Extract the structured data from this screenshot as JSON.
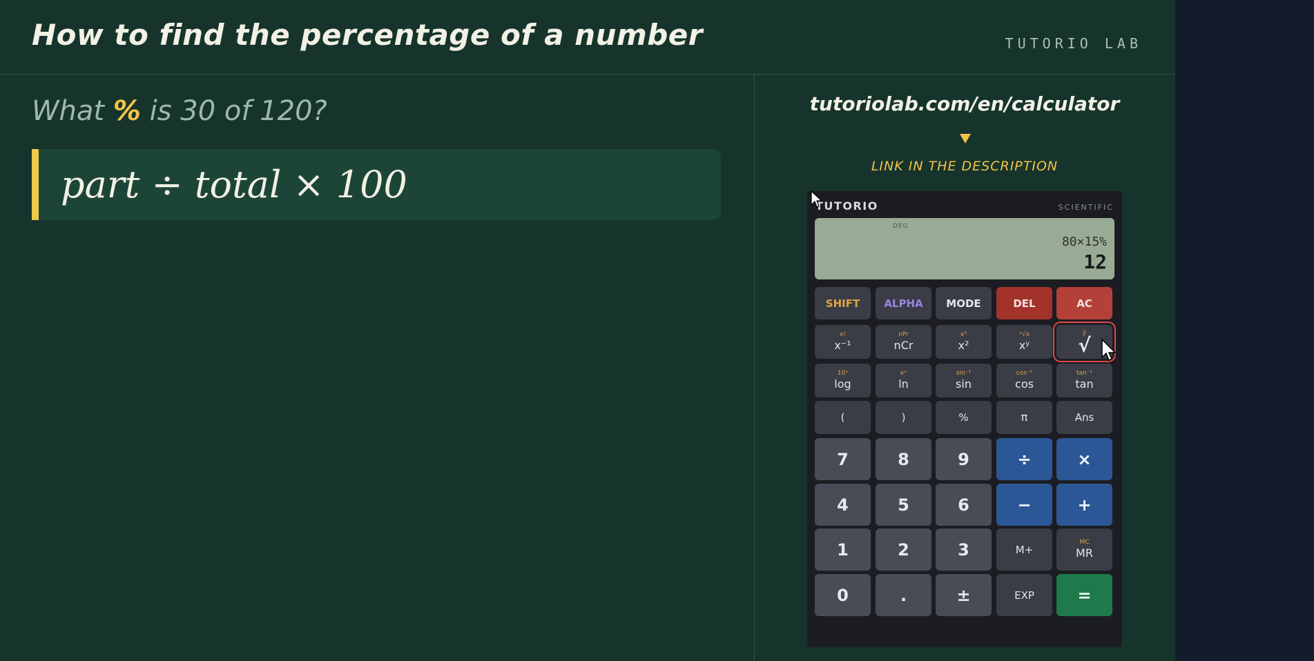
{
  "header": {
    "title": "How to find the percentage of a number",
    "brand": "TUTORIO LAB"
  },
  "lesson": {
    "question_prefix": "What",
    "question_symbol": "%",
    "question_suffix": "is 30 of 120?",
    "formula": "part ÷ total × 100"
  },
  "promo": {
    "url": "tutoriolab.com/en/calculator",
    "cta": "LINK IN THE DESCRIPTION"
  },
  "calculator": {
    "brand": "TUTORIO",
    "model": "SCIENTIFIC",
    "display": {
      "mode": "DEG",
      "expression": "80×15%",
      "result": "12"
    },
    "rows": [
      [
        {
          "name": "shift-key",
          "sub": "",
          "label": "SHIFT",
          "style": "top shift"
        },
        {
          "name": "alpha-key",
          "sub": "",
          "label": "ALPHA",
          "style": "top alpha"
        },
        {
          "name": "mode-key",
          "sub": "",
          "label": "MODE",
          "style": "top"
        },
        {
          "name": "del-key",
          "sub": "",
          "label": "DEL",
          "style": "top red"
        },
        {
          "name": "ac-key",
          "sub": "",
          "label": "AC",
          "style": "top red2"
        }
      ],
      [
        {
          "name": "reciprocal-key",
          "sub": "x!",
          "label": "x⁻¹",
          "style": ""
        },
        {
          "name": "ncr-key",
          "sub": "nPr",
          "label": "nCr",
          "style": ""
        },
        {
          "name": "square-key",
          "sub": "x³",
          "label": "x²",
          "style": ""
        },
        {
          "name": "power-key",
          "sub": "ˣ√x",
          "label": "xʸ",
          "style": ""
        },
        {
          "name": "sqrt-key",
          "sub": "∛",
          "label": "√",
          "style": "sel"
        }
      ],
      [
        {
          "name": "log-key",
          "sub": "10ˣ",
          "label": "log",
          "style": ""
        },
        {
          "name": "ln-key",
          "sub": "eˣ",
          "label": "ln",
          "style": ""
        },
        {
          "name": "sin-key",
          "sub": "sin⁻¹",
          "label": "sin",
          "style": ""
        },
        {
          "name": "cos-key",
          "sub": "cos⁻¹",
          "label": "cos",
          "style": ""
        },
        {
          "name": "tan-key",
          "sub": "tan⁻¹",
          "label": "tan",
          "style": ""
        }
      ],
      [
        {
          "name": "open-paren-key",
          "sub": "",
          "label": "(",
          "style": "small"
        },
        {
          "name": "close-paren-key",
          "sub": "",
          "label": ")",
          "style": "small"
        },
        {
          "name": "percent-key",
          "sub": "",
          "label": "%",
          "style": "small"
        },
        {
          "name": "pi-key",
          "sub": "",
          "label": "π",
          "style": ""
        },
        {
          "name": "ans-key",
          "sub": "",
          "label": "Ans",
          "style": "small"
        }
      ],
      [
        {
          "name": "digit-7-key",
          "sub": "",
          "label": "7",
          "style": "num"
        },
        {
          "name": "digit-8-key",
          "sub": "",
          "label": "8",
          "style": "num"
        },
        {
          "name": "digit-9-key",
          "sub": "",
          "label": "9",
          "style": "num"
        },
        {
          "name": "divide-key",
          "sub": "",
          "label": "÷",
          "style": "op"
        },
        {
          "name": "multiply-key",
          "sub": "",
          "label": "×",
          "style": "op"
        }
      ],
      [
        {
          "name": "digit-4-key",
          "sub": "",
          "label": "4",
          "style": "num"
        },
        {
          "name": "digit-5-key",
          "sub": "",
          "label": "5",
          "style": "num"
        },
        {
          "name": "digit-6-key",
          "sub": "",
          "label": "6",
          "style": "num"
        },
        {
          "name": "minus-key",
          "sub": "",
          "label": "−",
          "style": "op"
        },
        {
          "name": "plus-key",
          "sub": "",
          "label": "+",
          "style": "op"
        }
      ],
      [
        {
          "name": "digit-1-key",
          "sub": "",
          "label": "1",
          "style": "num"
        },
        {
          "name": "digit-2-key",
          "sub": "",
          "label": "2",
          "style": "num"
        },
        {
          "name": "digit-3-key",
          "sub": "",
          "label": "3",
          "style": "num"
        },
        {
          "name": "mplus-key",
          "sub": "",
          "label": "M+",
          "style": "small"
        },
        {
          "name": "mr-key",
          "sub": "MC",
          "label": "MR",
          "style": ""
        }
      ],
      [
        {
          "name": "digit-0-key",
          "sub": "",
          "label": "0",
          "style": "num"
        },
        {
          "name": "decimal-key",
          "sub": "",
          "label": ".",
          "style": "num"
        },
        {
          "name": "sign-key",
          "sub": "",
          "label": "±",
          "style": "num"
        },
        {
          "name": "exp-key",
          "sub": "",
          "label": "EXP",
          "style": "small"
        },
        {
          "name": "equals-key",
          "sub": "",
          "label": "=",
          "style": "eq"
        }
      ]
    ]
  }
}
